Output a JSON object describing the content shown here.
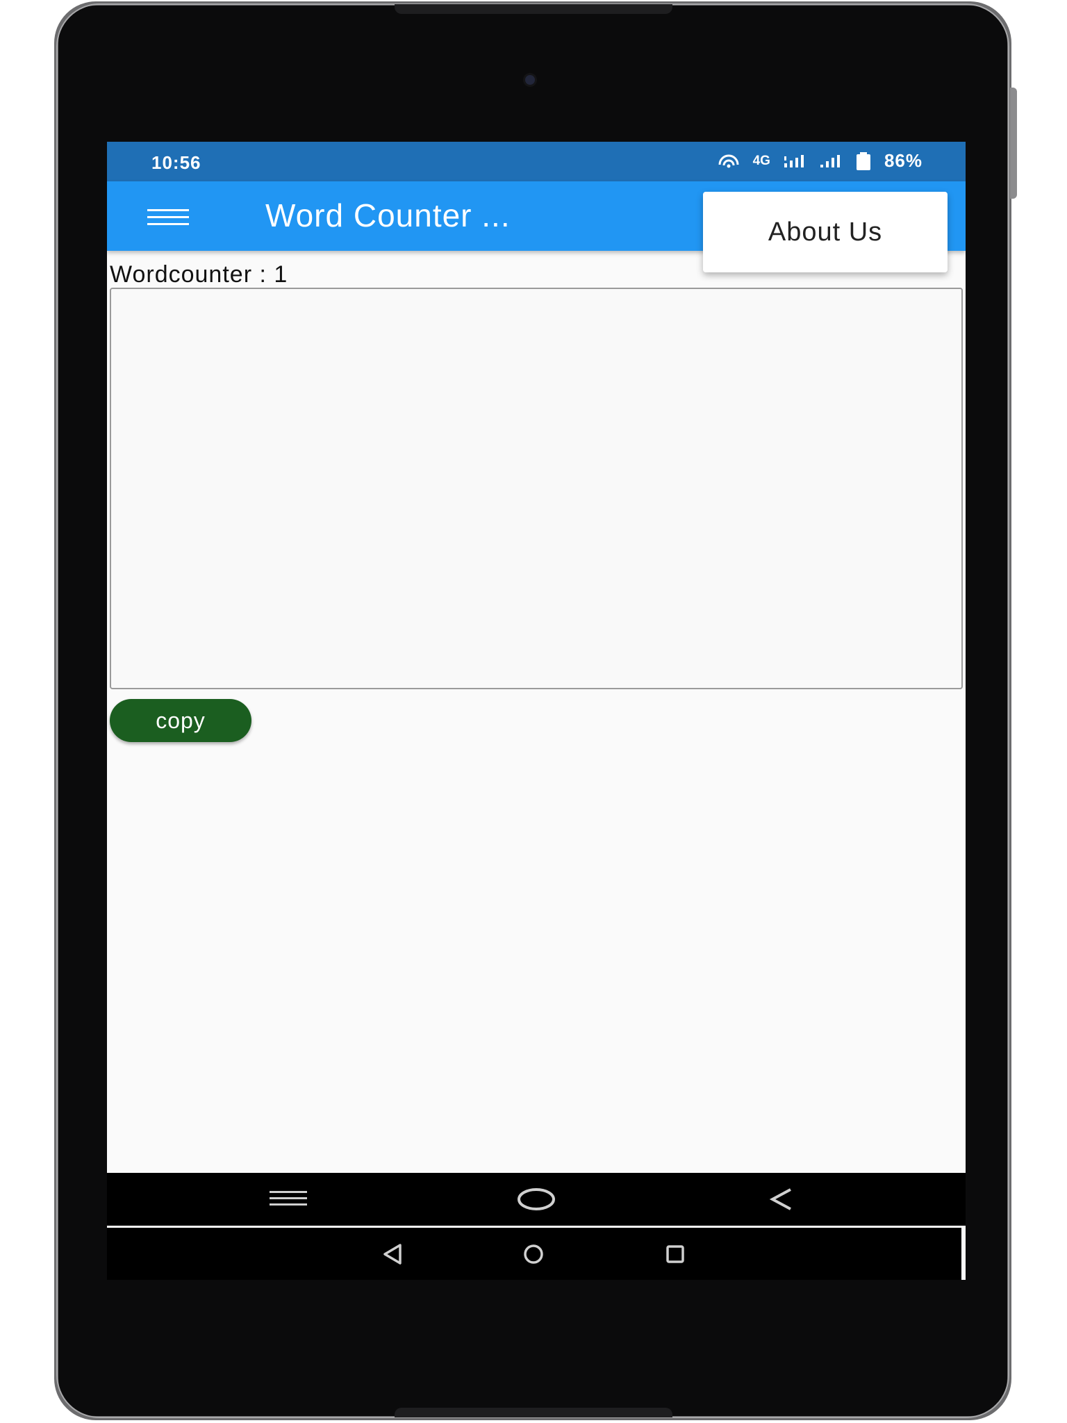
{
  "status_bar": {
    "time": "10:56",
    "network": "4G",
    "battery": "86%",
    "icons": [
      "hotspot-icon",
      "signal-icon",
      "signal-icon",
      "battery-icon"
    ]
  },
  "app_bar": {
    "title": "Word Counter ...",
    "menu_icon": "hamburger-menu-icon",
    "color": "#2196f3"
  },
  "overflow_menu": {
    "items": [
      {
        "label": "About Us"
      }
    ]
  },
  "main": {
    "counter_label": "Wordcounter : 1",
    "text_input": {
      "value": "",
      "placeholder": ""
    },
    "copy_button": {
      "label": "copy",
      "color": "#1b5e20"
    }
  },
  "nav_bars": {
    "app_nav": [
      "recents-lines-icon",
      "home-circle-icon",
      "back-chevron-icon"
    ],
    "system_nav": [
      "back-triangle-icon",
      "home-circle-icon",
      "overview-square-icon"
    ]
  }
}
